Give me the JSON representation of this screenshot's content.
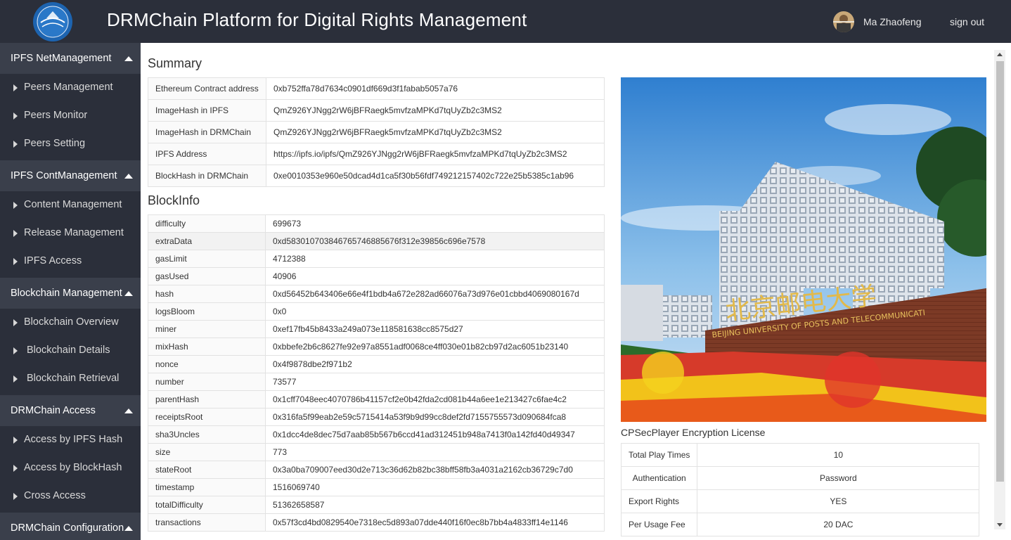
{
  "header": {
    "title": "DRMChain Platform for Digital Rights Management",
    "user_name": "Ma Zhaofeng",
    "sign_out": "sign out"
  },
  "sidebar": {
    "sections": [
      {
        "label": "IPFS NetManagement",
        "items": [
          {
            "label": "Peers Management"
          },
          {
            "label": "Peers Monitor"
          },
          {
            "label": "Peers Setting"
          }
        ]
      },
      {
        "label": "IPFS ContManagement",
        "items": [
          {
            "label": "Content Management"
          },
          {
            "label": "Release Management"
          },
          {
            "label": "IPFS Access"
          }
        ]
      },
      {
        "label": "Blockchain Management",
        "items": [
          {
            "label": "Blockchain Overview"
          },
          {
            "label": "Blockchain Details"
          },
          {
            "label": "Blockchain Retrieval"
          }
        ]
      },
      {
        "label": "DRMChain Access",
        "items": [
          {
            "label": "Access by IPFS Hash"
          },
          {
            "label": "Access by BlockHash"
          },
          {
            "label": "Cross Access"
          }
        ]
      },
      {
        "label": "DRMChain Configuration",
        "items": []
      }
    ]
  },
  "summary": {
    "title": "Summary",
    "rows": [
      {
        "key": "Ethereum Contract address",
        "value": "0xb752ffa78d7634c0901df669d3f1fabab5057a76"
      },
      {
        "key": "ImageHash in IPFS",
        "value": "QmZ926YJNgg2rW6jBFRaegk5mvfzaMPKd7tqUyZb2c3MS2"
      },
      {
        "key": "ImageHash in DRMChain",
        "value": "QmZ926YJNgg2rW6jBFRaegk5mvfzaMPKd7tqUyZb2c3MS2"
      },
      {
        "key": "IPFS Address",
        "value": "https://ipfs.io/ipfs/QmZ926YJNgg2rW6jBFRaegk5mvfzaMPKd7tqUyZb2c3MS2"
      },
      {
        "key": "BlockHash in DRMChain",
        "value": "0xe0010353e960e50dcad4d1ca5f30b56fdf749212157402c722e25b5385c1ab96"
      }
    ]
  },
  "blockinfo": {
    "title": "BlockInfo",
    "rows": [
      {
        "key": "difficulty",
        "value": "699673"
      },
      {
        "key": "extraData",
        "value": "0xd583010703846765746885676f312e39856c696e7578"
      },
      {
        "key": "gasLimit",
        "value": "4712388"
      },
      {
        "key": "gasUsed",
        "value": "40906"
      },
      {
        "key": "hash",
        "value": "0xd56452b643406e66e4f1bdb4a672e282ad66076a73d976e01cbbd4069080167d"
      },
      {
        "key": "logsBloom",
        "value": "0x0"
      },
      {
        "key": "miner",
        "value": "0xef17fb45b8433a249a073e118581638cc8575d27"
      },
      {
        "key": "mixHash",
        "value": "0xbbefe2b6c8627fe92e97a8551adf0068ce4ff030e01b82cb97d2ac6051b23140"
      },
      {
        "key": "nonce",
        "value": "0x4f9878dbe2f971b2"
      },
      {
        "key": "number",
        "value": "73577"
      },
      {
        "key": "parentHash",
        "value": "0x1cff7048eec4070786b41157cf2e0b42fda2cd081b44a6ee1e213427c6fae4c2"
      },
      {
        "key": "receiptsRoot",
        "value": "0x316fa5f99eab2e59c5715414a53f9b9d99cc8def2fd7155755573d090684fca8"
      },
      {
        "key": "sha3Uncles",
        "value": "0x1dcc4de8dec75d7aab85b567b6ccd41ad312451b948a7413f0a142fd40d49347"
      },
      {
        "key": "size",
        "value": "773"
      },
      {
        "key": "stateRoot",
        "value": "0x3a0ba709007eed30d2e713c36d62b82bc38bff58fb3a4031a2162cb36729c7d0"
      },
      {
        "key": "timestamp",
        "value": "1516069740"
      },
      {
        "key": "totalDifficulty",
        "value": "51362658587"
      },
      {
        "key": "transactions",
        "value": "0x57f3cd4bd0829540e7318ec5d893a07dde440f16f0ec8b7bb4a4833ff14e1146"
      }
    ]
  },
  "image": {
    "sign_text_cn": "北京邮电大学",
    "sign_text_en": "BEIJING UNIVERSITY OF POSTS AND TELECOMMUNICATI"
  },
  "license": {
    "title": "CPSecPlayer Encryption License",
    "rows": [
      {
        "key": "Total Play Times",
        "value": "10"
      },
      {
        "key": "Authentication",
        "value": "Password"
      },
      {
        "key": "Export Rights",
        "value": "YES"
      },
      {
        "key": "Per Usage Fee",
        "value": "20 DAC"
      }
    ]
  },
  "colors": {
    "topbar": "#2b2f3a",
    "sidebar": "#2b2f3a",
    "sidebar_section": "#3a3f4b",
    "table_border": "#e2e2e2"
  },
  "icons": {
    "logo": "university-seal-logo",
    "avatar": "user-avatar",
    "section_caret": "caret-up-icon",
    "item_bullet": "caret-right-icon"
  }
}
